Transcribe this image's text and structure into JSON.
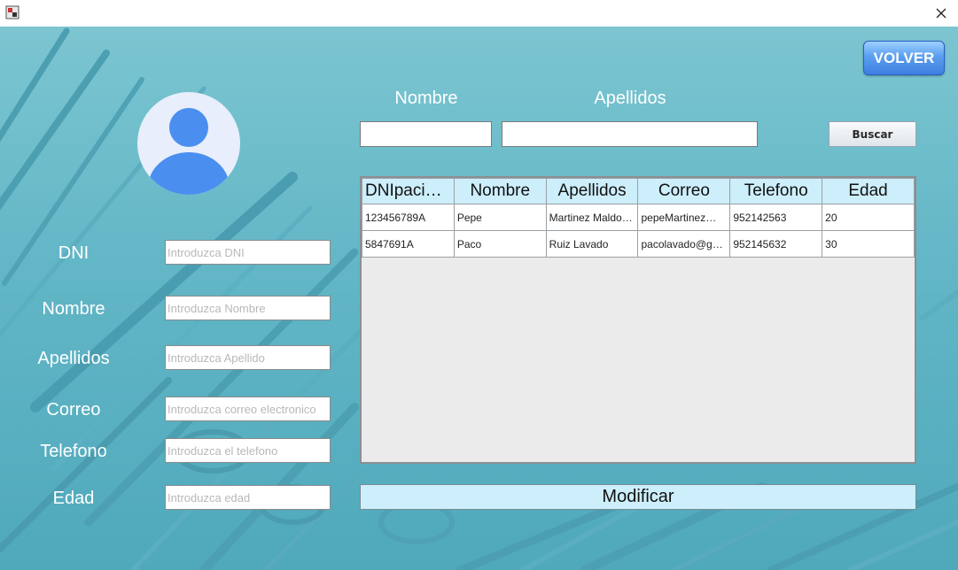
{
  "window": {
    "title": ""
  },
  "header": {
    "back_label": "VOLVER"
  },
  "search": {
    "nombre_label": "Nombre",
    "apellidos_label": "Apellidos",
    "nombre_value": "",
    "apellidos_value": "",
    "button_label": "Buscar"
  },
  "form": {
    "dni_label": "DNI",
    "dni_placeholder": "Introduzca DNI",
    "nombre_label": "Nombre",
    "nombre_placeholder": "Introduzca Nombre",
    "apellidos_label": "Apellidos",
    "apellidos_placeholder": "Introduzca Apellido",
    "correo_label": "Correo",
    "correo_placeholder": "Introduzca correo electronico",
    "telefono_label": "Telefono",
    "telefono_placeholder": "Introduzca el telefono",
    "edad_label": "Edad",
    "edad_placeholder": "Introduzca edad"
  },
  "table": {
    "columns": [
      "DNIpaciente",
      "Nombre",
      "Apellidos",
      "Correo",
      "Telefono",
      "Edad"
    ],
    "rows": [
      [
        "123456789A",
        "Pepe",
        "Martinez Maldonado",
        "pepeMartinez@gmail.com",
        "952142563",
        "20"
      ],
      [
        "5847691A",
        "Paco",
        "Ruiz Lavado",
        "pacolavado@gmail.com",
        "952145632",
        "30"
      ]
    ]
  },
  "actions": {
    "modify_label": "Modificar"
  },
  "icons": {
    "app": "app-icon",
    "close": "close-icon",
    "avatar": "user-avatar-icon"
  },
  "colors": {
    "header_cell": "#cdeefb",
    "volver_button": "#4a8fe8",
    "avatar_blue": "#4a8ff0"
  }
}
